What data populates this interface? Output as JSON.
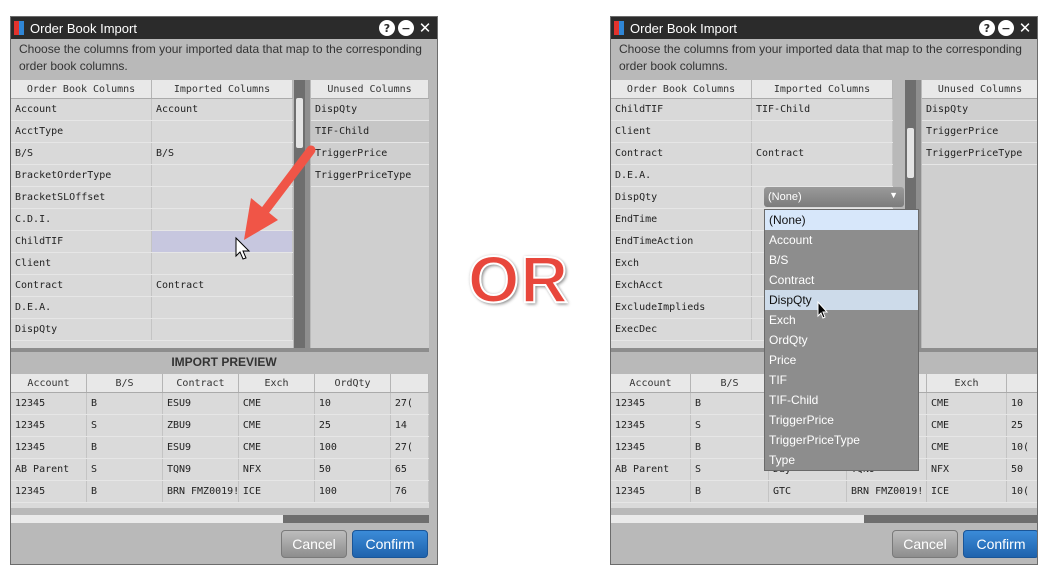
{
  "or_label": "OR",
  "dialog1": {
    "title": "Order Book Import",
    "instructions": "Choose the columns from your imported data that map to the corresponding order book columns.",
    "mapping_headers": [
      "Order Book Columns",
      "Imported Columns"
    ],
    "mapping_rows": [
      {
        "order": "Account",
        "imported": "Account"
      },
      {
        "order": "AcctType",
        "imported": ""
      },
      {
        "order": "B/S",
        "imported": "B/S"
      },
      {
        "order": "BracketOrderType",
        "imported": ""
      },
      {
        "order": "BracketSLOffset",
        "imported": ""
      },
      {
        "order": "C.D.I.",
        "imported": ""
      },
      {
        "order": "ChildTIF",
        "imported": ""
      },
      {
        "order": "Client",
        "imported": ""
      },
      {
        "order": "Contract",
        "imported": "Contract"
      },
      {
        "order": "D.E.A.",
        "imported": ""
      },
      {
        "order": "DispQty",
        "imported": ""
      }
    ],
    "unused_header": "Unused Columns",
    "unused_items": [
      "DispQty",
      "TIF-Child",
      "TriggerPrice",
      "TriggerPriceType"
    ],
    "preview_title": "IMPORT PREVIEW",
    "preview_headers": [
      "Account",
      "B/S",
      "Contract",
      "Exch",
      "OrdQty"
    ],
    "preview_rows": [
      [
        "12345",
        "B",
        "ESU9",
        "CME",
        "10",
        "27("
      ],
      [
        "12345",
        "S",
        "ZBU9",
        "CME",
        "25",
        "14"
      ],
      [
        "12345",
        "B",
        "ESU9",
        "CME",
        "100",
        "27("
      ],
      [
        "AB Parent",
        "S",
        "TQN9",
        "NFX",
        "50",
        "65"
      ],
      [
        "12345",
        "B",
        "BRN FMZ0019!",
        "ICE",
        "100",
        "76"
      ]
    ],
    "cancel_label": "Cancel",
    "confirm_label": "Confirm"
  },
  "dialog2": {
    "title": "Order Book Import",
    "instructions": "Choose the columns from your imported data that map to the corresponding order book columns.",
    "mapping_headers": [
      "Order Book Columns",
      "Imported Columns"
    ],
    "mapping_rows": [
      {
        "order": "ChildTIF",
        "imported": "TIF-Child"
      },
      {
        "order": "Client",
        "imported": ""
      },
      {
        "order": "Contract",
        "imported": "Contract"
      },
      {
        "order": "D.E.A.",
        "imported": ""
      },
      {
        "order": "DispQty",
        "imported": ""
      },
      {
        "order": "EndTime",
        "imported": ""
      },
      {
        "order": "EndTimeAction",
        "imported": ""
      },
      {
        "order": "Exch",
        "imported": ""
      },
      {
        "order": "ExchAcct",
        "imported": ""
      },
      {
        "order": "ExcludeImplieds",
        "imported": ""
      },
      {
        "order": "ExecDec",
        "imported": ""
      }
    ],
    "unused_header": "Unused Columns",
    "unused_items": [
      "DispQty",
      "TriggerPrice",
      "TriggerPriceType"
    ],
    "dropdown_value": "(None)",
    "menu_items": [
      "(None)",
      "Account",
      "B/S",
      "Contract",
      "DispQty",
      "Exch",
      "OrdQty",
      "Price",
      "TIF",
      "TIF-Child",
      "TriggerPrice",
      "TriggerPriceType",
      "Type"
    ],
    "preview_headers": [
      "Account",
      "B/S",
      "",
      "t",
      "Exch"
    ],
    "preview_rows": [
      [
        "12345",
        "B",
        "",
        "",
        "CME",
        "10"
      ],
      [
        "12345",
        "S",
        "",
        "",
        "CME",
        "25"
      ],
      [
        "12345",
        "B",
        "",
        "",
        "CME",
        "10("
      ],
      [
        "AB Parent",
        "S",
        "Day",
        "TQN9",
        "NFX",
        "50"
      ],
      [
        "12345",
        "B",
        "GTC",
        "BRN FMZ0019!",
        "ICE",
        "10("
      ]
    ],
    "cancel_label": "Cancel",
    "confirm_label": "Confirm"
  },
  "colors": {
    "arrow": "#f05547",
    "confirm": "#2a74c5",
    "or_text": "#e8473c"
  }
}
